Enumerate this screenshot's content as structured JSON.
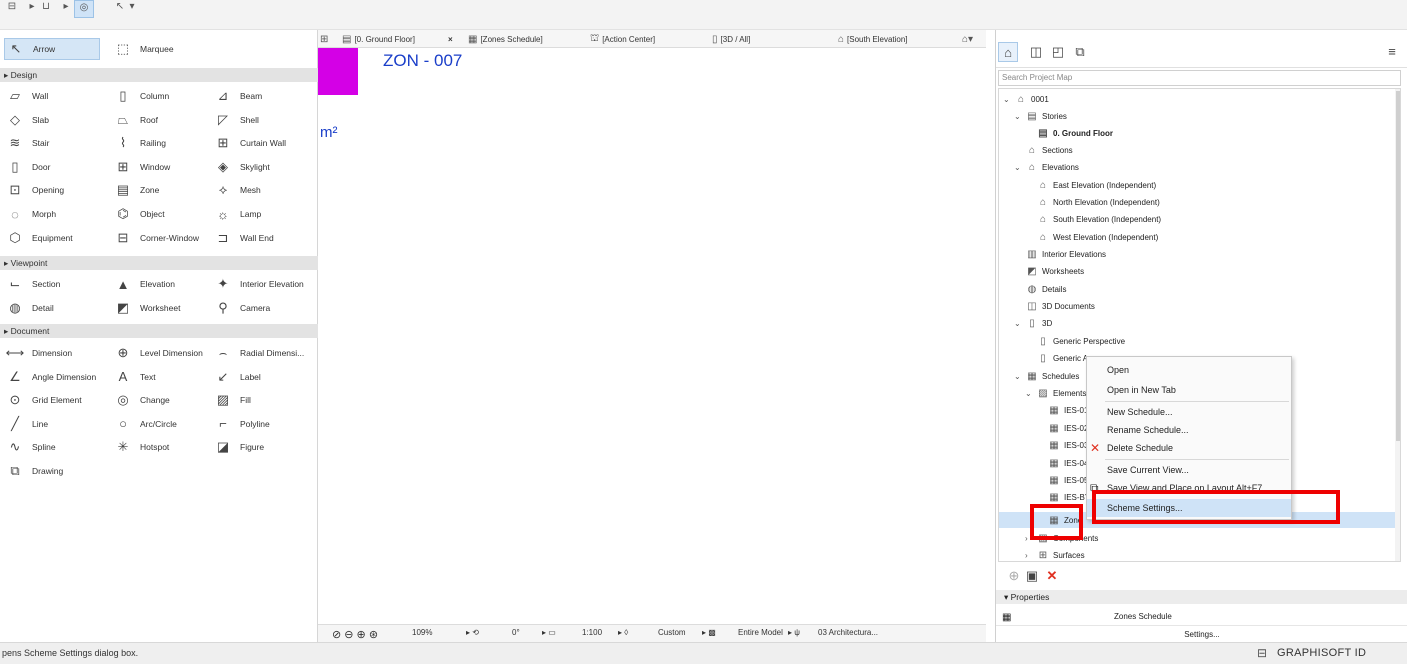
{
  "toolbox": {
    "arrow": "Arrow",
    "marquee": "Marquee",
    "sections": {
      "design": "Design",
      "viewpoint": "Viewpoint",
      "document": "Document"
    },
    "design_tools": [
      [
        "Wall",
        "Column",
        "Beam"
      ],
      [
        "Slab",
        "Roof",
        "Shell"
      ],
      [
        "Stair",
        "Railing",
        "Curtain Wall"
      ],
      [
        "Door",
        "Window",
        "Skylight"
      ],
      [
        "Opening",
        "Zone",
        "Mesh"
      ],
      [
        "Morph",
        "Object",
        "Lamp"
      ],
      [
        "Equipment",
        "Corner-Window",
        "Wall End"
      ]
    ],
    "viewpoint_tools": [
      [
        "Section",
        "Elevation",
        "Interior Elevation"
      ],
      [
        "Detail",
        "Worksheet",
        "Camera"
      ]
    ],
    "document_tools": [
      [
        "Dimension",
        "Level Dimension",
        "Radial Dimensi..."
      ],
      [
        "Angle Dimension",
        "Text",
        "Label"
      ],
      [
        "Grid Element",
        "Change",
        "Fill"
      ],
      [
        "Line",
        "Arc/Circle",
        "Polyline"
      ],
      [
        "Spline",
        "Hotspot",
        "Figure"
      ],
      [
        "Drawing",
        "",
        ""
      ]
    ]
  },
  "tabs": [
    "[0. Ground Floor]",
    "[Zones Schedule]",
    "[Action Center]",
    "[3D / All]",
    "[South Elevation]"
  ],
  "canvas": {
    "zone_label": "ZON - 007",
    "zone_area": "m²",
    "zone_color": "#d400e6"
  },
  "canvas_bottom": {
    "zoom": "109%",
    "angle": "0°",
    "scale": "1:100",
    "layer": "Custom",
    "model": "Entire Model",
    "pen": "03 Architectura..."
  },
  "project_map": {
    "search_placeholder": "Search Project Map",
    "nodes": [
      {
        "label": "0001",
        "indent": 0,
        "chev": "v",
        "icon": "⌂"
      },
      {
        "label": "Stories",
        "indent": 1,
        "chev": "v",
        "icon": "▤"
      },
      {
        "label": "0. Ground Floor",
        "indent": 2,
        "chev": "",
        "icon": "▤",
        "bold": true
      },
      {
        "label": "Sections",
        "indent": 1,
        "chev": "",
        "icon": "⌂"
      },
      {
        "label": "Elevations",
        "indent": 1,
        "chev": "v",
        "icon": "⌂"
      },
      {
        "label": "East Elevation (Independent)",
        "indent": 2,
        "chev": "",
        "icon": "⌂"
      },
      {
        "label": "North Elevation (Independent)",
        "indent": 2,
        "chev": "",
        "icon": "⌂"
      },
      {
        "label": "South Elevation (Independent)",
        "indent": 2,
        "chev": "",
        "icon": "⌂"
      },
      {
        "label": "West Elevation (Independent)",
        "indent": 2,
        "chev": "",
        "icon": "⌂"
      },
      {
        "label": "Interior Elevations",
        "indent": 1,
        "chev": "",
        "icon": "▥"
      },
      {
        "label": "Worksheets",
        "indent": 1,
        "chev": "",
        "icon": "◩"
      },
      {
        "label": "Details",
        "indent": 1,
        "chev": "",
        "icon": "◍"
      },
      {
        "label": "3D Documents",
        "indent": 1,
        "chev": "",
        "icon": "◫"
      },
      {
        "label": "3D",
        "indent": 1,
        "chev": "v",
        "icon": "▯"
      },
      {
        "label": "Generic Perspective",
        "indent": 2,
        "chev": "",
        "icon": "▯"
      },
      {
        "label": "Generic A",
        "indent": 2,
        "chev": "",
        "icon": "▯"
      },
      {
        "label": "Schedules",
        "indent": 1,
        "chev": "v",
        "icon": "▦"
      },
      {
        "label": "Elements",
        "indent": 2,
        "chev": "v",
        "icon": "▨"
      },
      {
        "label": "IES-01",
        "indent": 3,
        "chev": "",
        "icon": "▦"
      },
      {
        "label": "IES-02",
        "indent": 3,
        "chev": "",
        "icon": "▦"
      },
      {
        "label": "IES-03",
        "indent": 3,
        "chev": "",
        "icon": "▦"
      },
      {
        "label": "IES-04",
        "indent": 3,
        "chev": "",
        "icon": "▦"
      },
      {
        "label": "IES-05",
        "indent": 3,
        "chev": "",
        "icon": "▦"
      },
      {
        "label": "IES-BY",
        "indent": 3,
        "chev": "",
        "icon": "▦"
      },
      {
        "label": "Zone",
        "indent": 3,
        "chev": "",
        "icon": "▦"
      },
      {
        "label": "Components",
        "indent": 2,
        "chev": ">",
        "icon": "▨"
      },
      {
        "label": "Surfaces",
        "indent": 2,
        "chev": ">",
        "icon": "⊞"
      }
    ]
  },
  "properties": {
    "header": "Properties",
    "value": "Zones Schedule",
    "settings": "Settings..."
  },
  "context_menu": {
    "items": [
      "Open",
      "Open in New Tab",
      "New Schedule...",
      "Rename Schedule...",
      "Delete Schedule",
      "Save Current View...",
      "Save View and Place on Layout",
      "Scheme Settings..."
    ],
    "shortcut": "Alt+F7"
  },
  "status": {
    "text": "pens Scheme Settings dialog box.",
    "brand": "GRAPHISOFT ID"
  },
  "colors": {
    "highlight": "#ee0000",
    "selection": "#cfe3f7",
    "link_blue": "#1a3ec9"
  }
}
